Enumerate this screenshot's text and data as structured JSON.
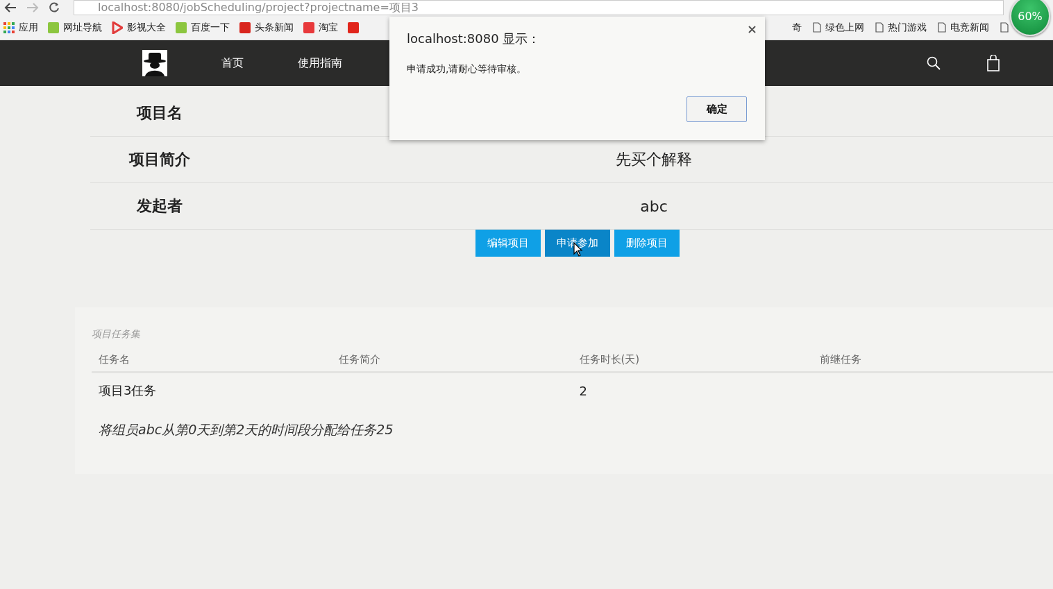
{
  "browser": {
    "url": "localhost:8080/jobScheduling/project?projectname=项目3",
    "bookmarks": [
      {
        "kind": "apps",
        "label": "应用"
      },
      {
        "kind": "brand",
        "label": "网址导航",
        "color": "#8cc63f"
      },
      {
        "kind": "play",
        "label": "影视大全",
        "color": "#e23b3b"
      },
      {
        "kind": "brand",
        "label": "百度一下",
        "color": "#8cc63f"
      },
      {
        "kind": "brand",
        "label": "头条新闻",
        "color": "#d9251d"
      },
      {
        "kind": "brand",
        "label": "淘宝",
        "color": "#e8393b"
      },
      {
        "kind": "brand",
        "color": "#e1251b"
      }
    ],
    "bookmarks_right": [
      {
        "kind": "text",
        "label": "奇"
      },
      {
        "kind": "page",
        "label": "绿色上网"
      },
      {
        "kind": "page",
        "label": "热门游戏"
      },
      {
        "kind": "page",
        "label": "电竞新闻"
      },
      {
        "kind": "page"
      }
    ],
    "badge": "60%"
  },
  "nav": {
    "items": [
      {
        "label": "首页"
      },
      {
        "label": "使用指南"
      }
    ]
  },
  "project": {
    "fields": [
      {
        "label": "项目名"
      },
      {
        "label": "项目简介",
        "value": "先买个解释"
      },
      {
        "label": "发起者",
        "value": "abc"
      }
    ],
    "buttons": [
      {
        "label": "编辑项目",
        "hovered": false
      },
      {
        "label": "申请参加",
        "hovered": true
      },
      {
        "label": "删除项目",
        "hovered": false
      }
    ]
  },
  "tasks": {
    "caption": "项目任务集",
    "columns": [
      "任务名",
      "任务简介",
      "任务时长(天)",
      "前继任务"
    ],
    "rows": [
      [
        "项目3任务",
        "",
        "2",
        ""
      ]
    ],
    "note": "将组员abc从第0天到第2天的时间段分配给任务25"
  },
  "dialog": {
    "title": "localhost:8080 显示：",
    "message": "申请成功,请耐心等待审核。",
    "button": "确定"
  }
}
